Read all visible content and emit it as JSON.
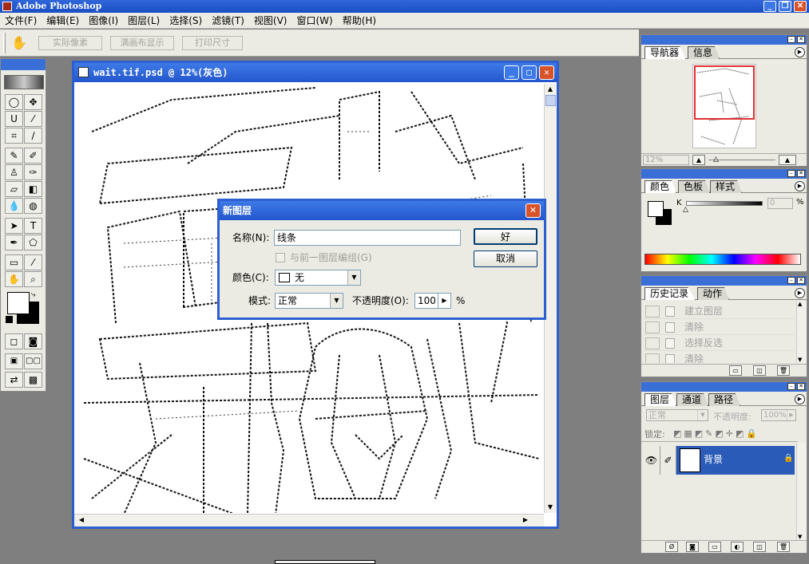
{
  "app": {
    "title": "Adobe Photoshop"
  },
  "menu": [
    "文件(F)",
    "编辑(E)",
    "图像(I)",
    "图层(L)",
    "选择(S)",
    "滤镜(T)",
    "视图(V)",
    "窗口(W)",
    "帮助(H)"
  ],
  "options_bar": {
    "btn1": "实际像素",
    "btn2": "满画布显示",
    "btn3": "打印尺寸"
  },
  "document": {
    "title": "wait.tif.psd @ 12%(灰色)"
  },
  "dialog": {
    "title": "新图层",
    "name_label": "名称(N):",
    "name_value": "线条",
    "group_label": "与前一图层编组(G)",
    "color_label": "颜色(C):",
    "color_value": "无",
    "mode_label": "模式:",
    "mode_value": "正常",
    "opacity_label": "不透明度(O):",
    "opacity_value": "100",
    "opacity_unit": "%",
    "ok": "好",
    "cancel": "取消"
  },
  "navigator": {
    "tabs": [
      "导航器",
      "信息"
    ],
    "zoom": "12%"
  },
  "color_panel": {
    "tabs": [
      "颜色",
      "色板",
      "样式"
    ],
    "channel": "K",
    "value": "0",
    "unit": "%"
  },
  "history": {
    "tabs": [
      "历史记录",
      "动作"
    ],
    "items": [
      "建立图层",
      "清除",
      "选择反选",
      "清除"
    ]
  },
  "layers": {
    "tabs": [
      "图层",
      "通道",
      "路径"
    ],
    "blend_mode": "正常",
    "opacity_label": "不透明度:",
    "opacity_value": "100%",
    "lock_label": "锁定:",
    "layer_name": "背景"
  },
  "colors": {
    "titlebar": "#2356cc",
    "selection": "#2b5bb8",
    "panel_bg": "#ecebe3"
  }
}
